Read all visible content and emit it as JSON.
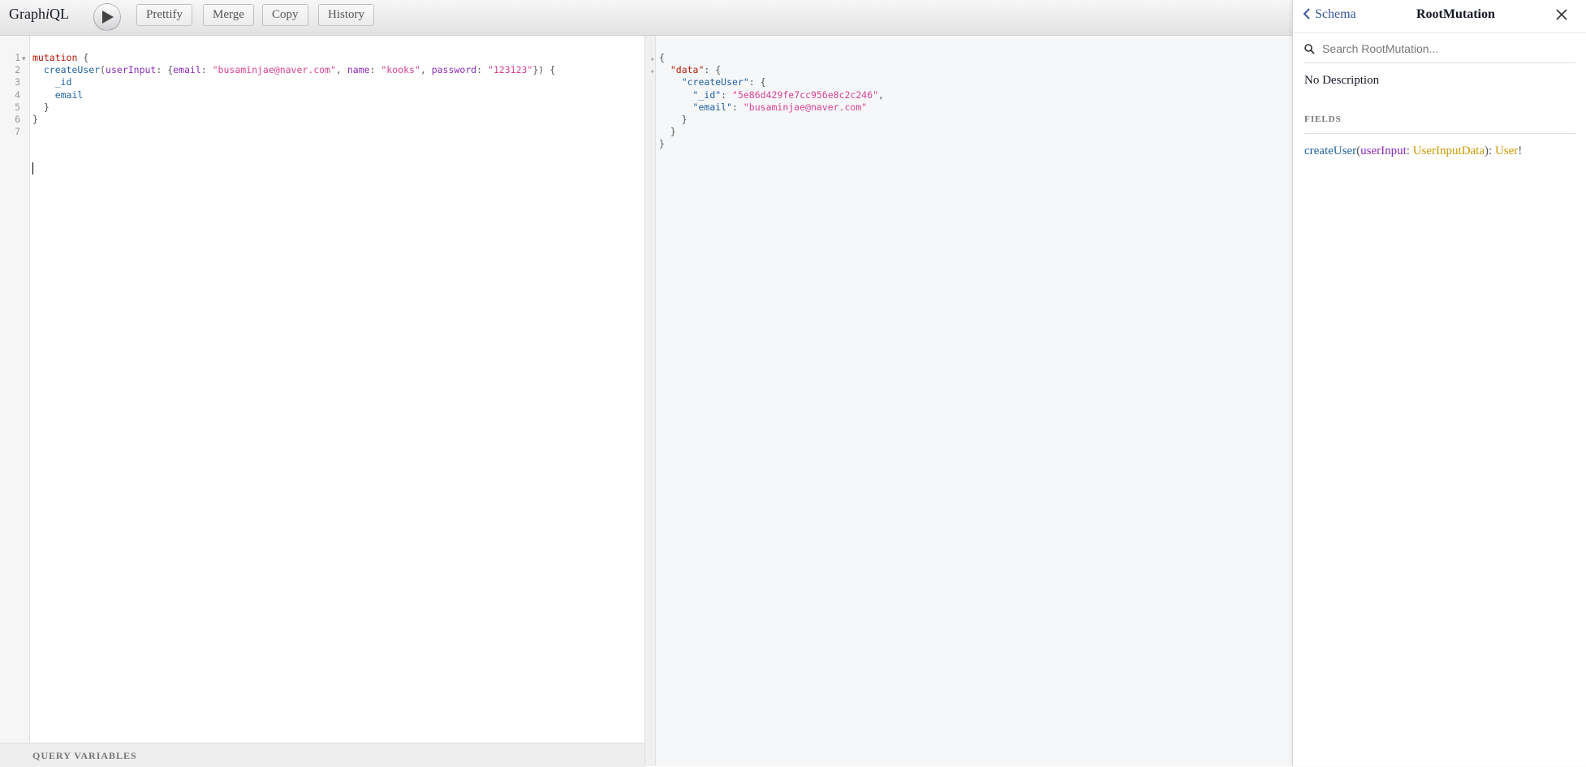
{
  "app": {
    "title_prefix": "Graph",
    "title_italic": "i",
    "title_suffix": "QL"
  },
  "toolbar": {
    "execute_icon": "play-icon",
    "buttons": [
      "Prettify",
      "Merge",
      "Copy",
      "History"
    ]
  },
  "query_editor": {
    "line_numbers": [
      "1",
      "2",
      "3",
      "4",
      "5",
      "6",
      "7"
    ],
    "lines": {
      "l1_kw": "mutation",
      "l1_punc": " {",
      "l2_indent": "  ",
      "l2_field": "createUser",
      "l2_p1": "(",
      "l2_arg": "userInput",
      "l2_p2": ": {",
      "l2_a1": "email",
      "l2_p3": ": ",
      "l2_s1": "\"busaminjae@naver.com\"",
      "l2_p4": ", ",
      "l2_a2": "name",
      "l2_p5": ": ",
      "l2_s2": "\"kooks\"",
      "l2_p6": ", ",
      "l2_a3": "password",
      "l2_p7": ": ",
      "l2_s3": "\"123123\"",
      "l2_p8": "}) {",
      "l3": "    _id",
      "l4": "    email",
      "l5": "  }",
      "l6": "}"
    }
  },
  "query_variables": {
    "label": "QUERY VARIABLES"
  },
  "result": {
    "l1": "{",
    "l2_key": "\"data\"",
    "l2_punc": ": {",
    "l3_key": "\"createUser\"",
    "l3_punc": ": {",
    "l4_key": "\"_id\"",
    "l4_punc1": ": ",
    "l4_val": "\"5e86d429fe7cc956e8c2c246\"",
    "l4_punc2": ",",
    "l5_key": "\"email\"",
    "l5_punc": ": ",
    "l5_val": "\"busaminjae@naver.com\"",
    "l6": "    }",
    "l7": "  }",
    "l8": "}"
  },
  "doc_explorer": {
    "back_label": "Schema",
    "title": "RootMutation",
    "search_placeholder": "Search RootMutation...",
    "description": "No Description",
    "fields_title": "FIELDS",
    "field": {
      "name": "createUser",
      "p1": "(",
      "arg": "userInput",
      "p2": ": ",
      "arg_type": "UserInputData",
      "p3": "): ",
      "return_type": "User",
      "p4": "!"
    }
  },
  "colors": {
    "keyword": "#B11A04",
    "field": "#1F61A0",
    "argument": "#8B2BB9",
    "string": "#D64292",
    "type": "#CA9800",
    "link": "#3B5998"
  }
}
